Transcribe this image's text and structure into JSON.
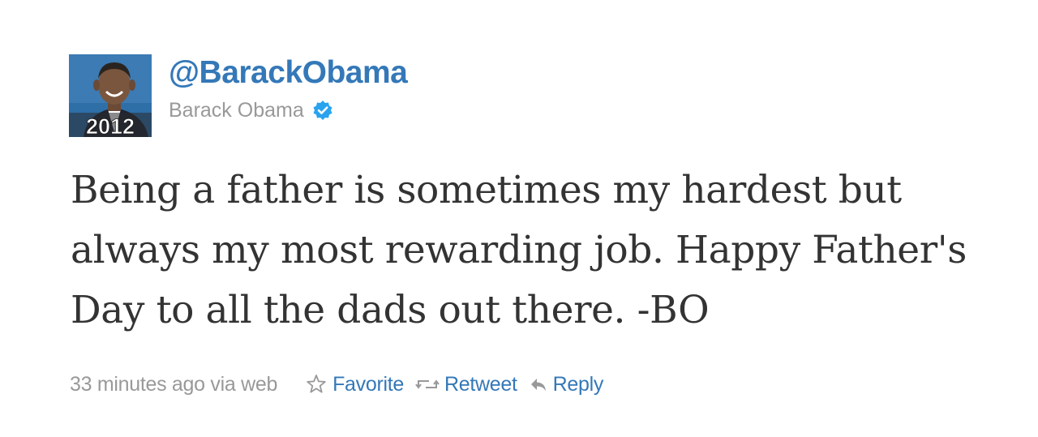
{
  "tweet": {
    "screen_name": "@BarackObama",
    "full_name": "Barack Obama",
    "text": "Being a father is sometimes my hardest but always my most rewarding job. Happy Father's Day to all the dads out there. -BO",
    "timestamp": "33 minutes ago via web",
    "avatar": {
      "badge_text": "2012"
    },
    "verified_icon": "verified-badge-icon"
  },
  "actions": {
    "favorite_label": "Favorite",
    "retweet_label": "Retweet",
    "reply_label": "Reply",
    "favorite_icon": "star-icon",
    "retweet_icon": "retweet-icon",
    "reply_icon": "reply-arrow-icon"
  },
  "colors": {
    "link_blue": "#3478b8",
    "name_gray": "#999999",
    "text_dark": "#333333",
    "avatar_blue": "#2e6fa8",
    "verified_blue": "#2aa3ef"
  }
}
